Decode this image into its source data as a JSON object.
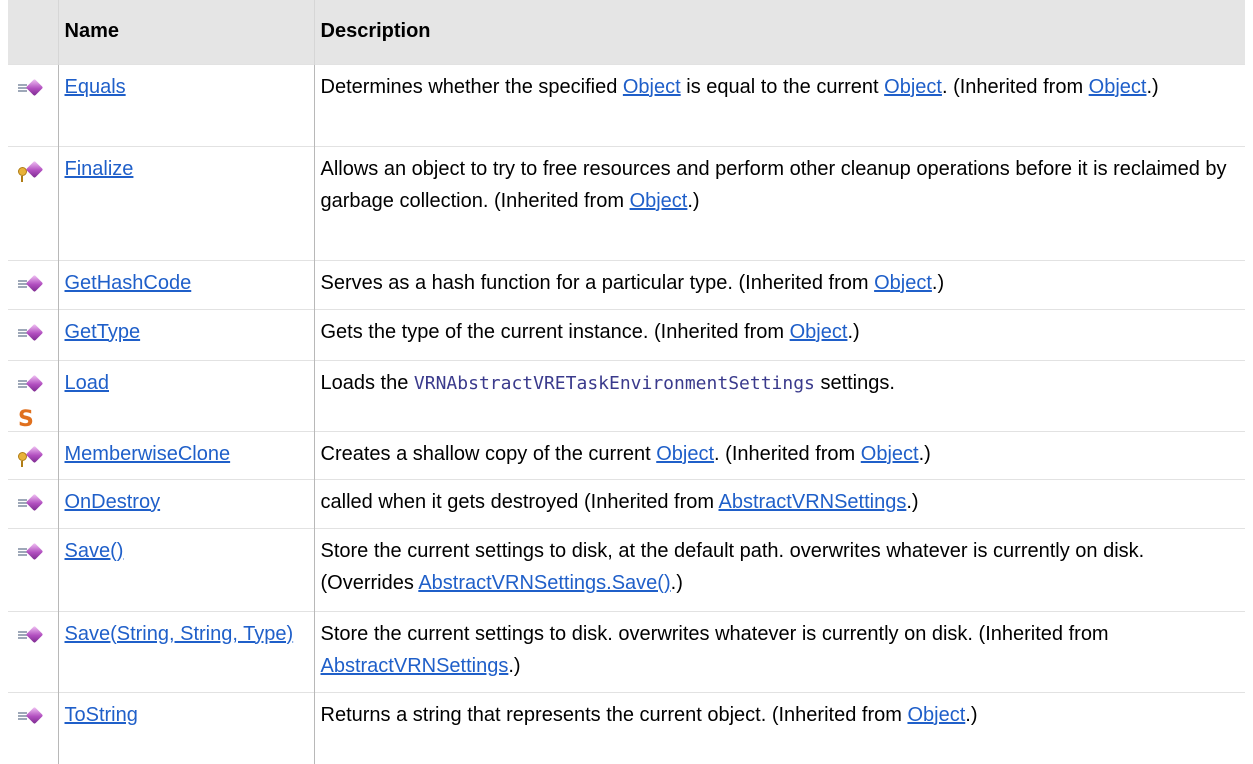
{
  "table": {
    "headers": {
      "name": "Name",
      "description": "Description"
    },
    "rows": {
      "equals": {
        "icon": "public-method-icon",
        "name": "Equals",
        "desc_a": "Determines whether the specified ",
        "link_a": "Object",
        "desc_b": " is equal to the current ",
        "link_b": "Object",
        "desc_c": ". (Inherited from ",
        "link_c": "Object",
        "desc_d": ".)"
      },
      "finalize": {
        "icon": "protected-method-icon",
        "name": "Finalize",
        "desc_a": "Allows an object to try to free resources and perform other cleanup operations before it is reclaimed by garbage collection. (Inherited from ",
        "link_a": "Object",
        "desc_b": ".)"
      },
      "gethashcode": {
        "icon": "public-method-icon",
        "name": "GetHashCode",
        "desc_a": "Serves as a hash function for a particular type. (Inherited from ",
        "link_a": "Object",
        "desc_b": ".)"
      },
      "gettype": {
        "icon": "public-method-icon",
        "name": "GetType",
        "desc_a": "Gets the type of the current instance. (Inherited from ",
        "link_a": "Object",
        "desc_b": ".)"
      },
      "load": {
        "icon": "public-static-method-icon",
        "static_mark": "S",
        "name": "Load",
        "desc_a": "Loads the ",
        "code": "VRNAbstractVRETaskEnvironmentSettings",
        "desc_b": " settings."
      },
      "memberwiseclone": {
        "icon": "protected-method-icon",
        "name": "MemberwiseClone",
        "desc_a": "Creates a shallow copy of the current ",
        "link_a": "Object",
        "desc_b": ". (Inherited from ",
        "link_b": "Object",
        "desc_c": ".)"
      },
      "ondestroy": {
        "icon": "public-method-icon",
        "name": "OnDestroy",
        "desc_a": "called when it gets destroyed (Inherited from ",
        "link_a": "AbstractVRNSettings",
        "desc_b": ".)"
      },
      "save": {
        "icon": "public-method-icon",
        "name": "Save()",
        "desc_a": "Store the current settings to disk, at the default path. overwrites whatever is currently on disk. (Overrides ",
        "link_a": "AbstractVRNSettings.Save()",
        "desc_b": ".)"
      },
      "savestring": {
        "icon": "public-method-icon",
        "name": "Save(String, String, Type)",
        "desc_a": "Store the current settings to disk. overwrites whatever is currently on disk. (Inherited from ",
        "link_a": "AbstractVRNSettings",
        "desc_b": ".)"
      },
      "tostring": {
        "icon": "public-method-icon",
        "name": "ToString",
        "desc_a": "Returns a string that represents the current object. (Inherited from ",
        "link_a": "Object",
        "desc_b": ".)"
      }
    }
  }
}
